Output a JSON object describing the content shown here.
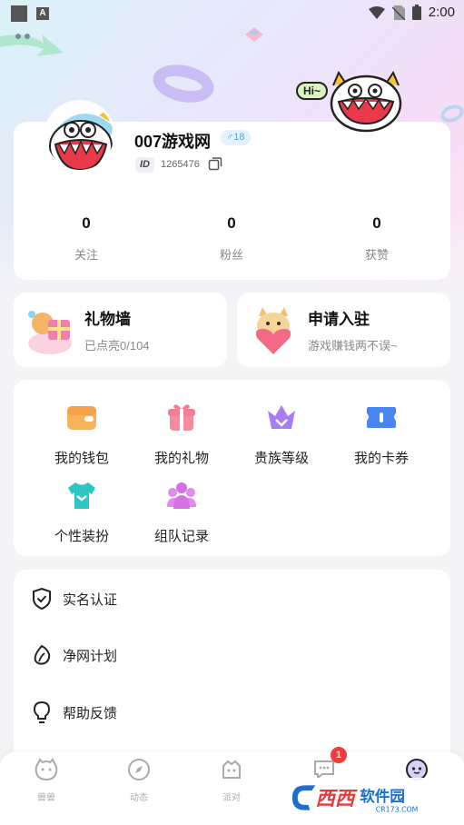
{
  "status_bar": {
    "time": "2:00",
    "a_label": "A"
  },
  "profile": {
    "username": "007游戏网",
    "gender_badge": "♂18",
    "id_label": "ID",
    "id_number": "1265476",
    "hi_text": "Hi~",
    "stats": [
      {
        "value": "0",
        "label": "关注"
      },
      {
        "value": "0",
        "label": "粉丝"
      },
      {
        "value": "0",
        "label": "获赞"
      }
    ]
  },
  "gift_wall": {
    "title": "礼物墙",
    "subtitle": "已点亮0/104"
  },
  "apply": {
    "title": "申请入驻",
    "subtitle": "游戏赚钱两不误~"
  },
  "grid": [
    {
      "label": "我的钱包",
      "icon": "wallet-icon",
      "color": "#f5a04a"
    },
    {
      "label": "我的礼物",
      "icon": "gift-icon",
      "color": "#f27e93"
    },
    {
      "label": "贵族等级",
      "icon": "crown-icon",
      "color": "#9b6cf2"
    },
    {
      "label": "我的卡券",
      "icon": "ticket-icon",
      "color": "#4a86f2"
    },
    {
      "label": "个性装扮",
      "icon": "tshirt-icon",
      "color": "#2ec5c5"
    },
    {
      "label": "组队记录",
      "icon": "team-icon",
      "color": "#d86fe6"
    }
  ],
  "list": [
    {
      "label": "实名认证",
      "icon": "shield-check-icon"
    },
    {
      "label": "净网计划",
      "icon": "leaf-icon"
    },
    {
      "label": "帮助反馈",
      "icon": "lightbulb-icon"
    }
  ],
  "nav": [
    {
      "label": "兽兽",
      "icon": "beast-icon"
    },
    {
      "label": "动态",
      "icon": "compass-icon"
    },
    {
      "label": "派对",
      "icon": "party-icon"
    },
    {
      "label": "消息",
      "icon": "message-icon"
    },
    {
      "label": "",
      "icon": "profile-icon"
    }
  ],
  "nav_badge": "1",
  "watermark": {
    "brand": "西西",
    "text": "软件园",
    "url": "CR173.COM"
  }
}
